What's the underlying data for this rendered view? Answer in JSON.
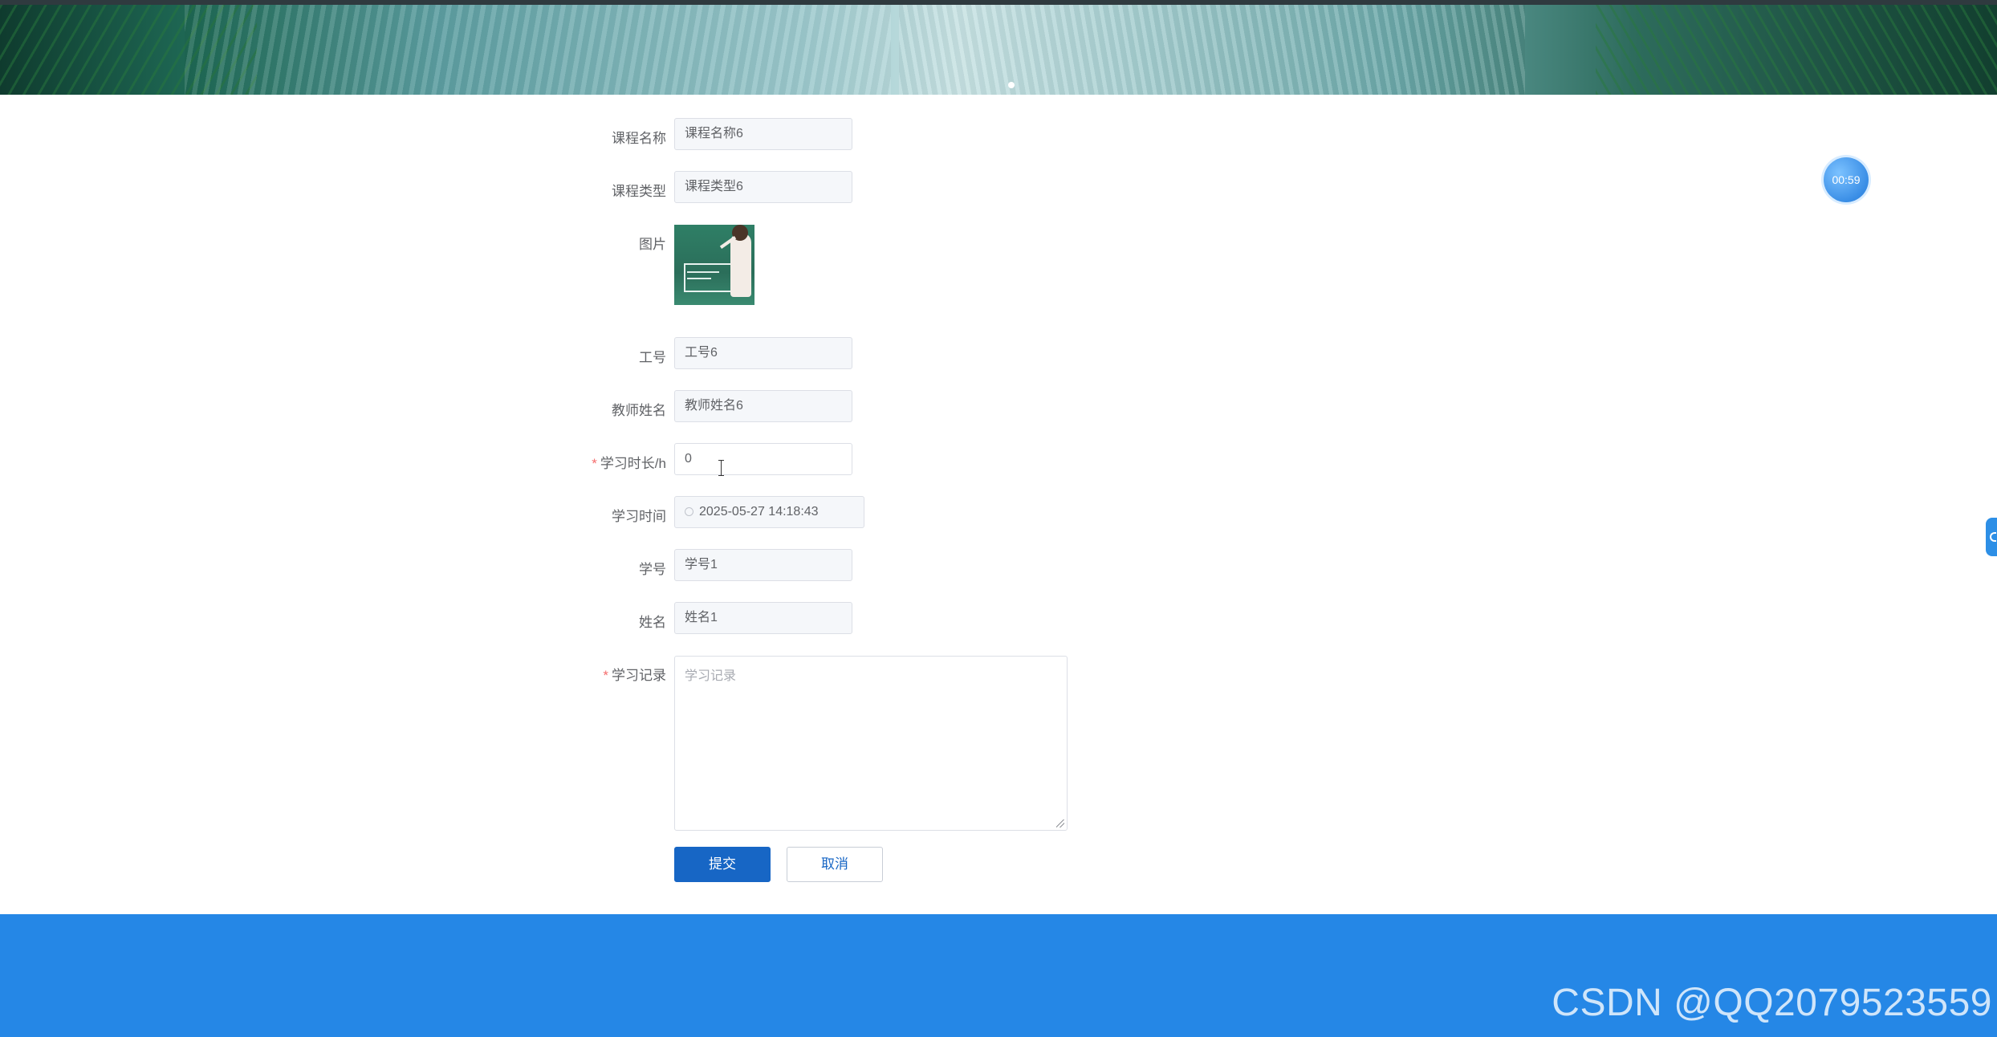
{
  "form": {
    "course_name": {
      "label": "课程名称",
      "value": "课程名称6"
    },
    "course_type": {
      "label": "课程类型",
      "value": "课程类型6"
    },
    "image": {
      "label": "图片"
    },
    "job_number": {
      "label": "工号",
      "value": "工号6"
    },
    "teacher_name": {
      "label": "教师姓名",
      "value": "教师姓名6"
    },
    "study_hours": {
      "label": "学习时长/h",
      "required": "*",
      "value": "0"
    },
    "study_time": {
      "label": "学习时间",
      "value": "2025-05-27 14:18:43"
    },
    "student_id": {
      "label": "学号",
      "value": "学号1"
    },
    "student_name": {
      "label": "姓名",
      "value": "姓名1"
    },
    "study_record": {
      "label": "学习记录",
      "required": "*",
      "placeholder": "学习记录"
    }
  },
  "buttons": {
    "submit": "提交",
    "cancel": "取消"
  },
  "timer": {
    "text": "00:59"
  },
  "watermark": "CSDN @QQ2079523559",
  "colors": {
    "primary": "#1766c5",
    "footer": "#2587e6",
    "required": "#f56c6c"
  }
}
